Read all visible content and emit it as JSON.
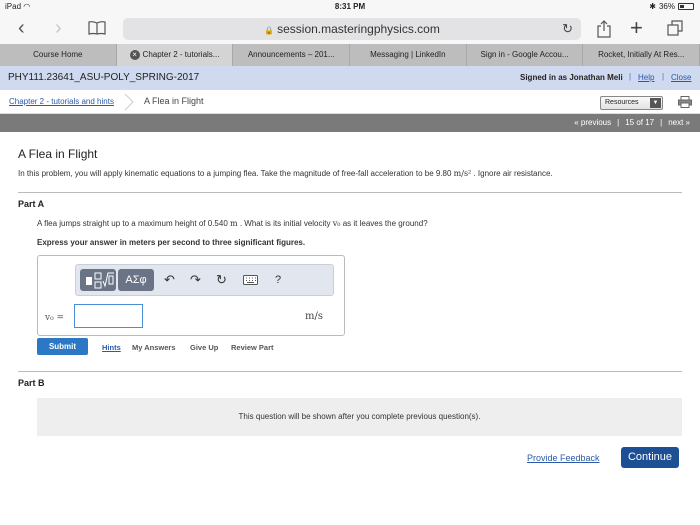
{
  "statusbar": {
    "device": "iPad",
    "time": "8:31 PM",
    "battery": "36%",
    "battery_level": 0.36
  },
  "browser": {
    "url": "session.masteringphysics.com"
  },
  "tabs": [
    {
      "label": "Course Home",
      "active": false
    },
    {
      "label": "Chapter 2 - tutorials...",
      "active": true
    },
    {
      "label": "Announcements – 201...",
      "active": false
    },
    {
      "label": "Messaging | LinkedIn",
      "active": false
    },
    {
      "label": "Sign in - Google Accou...",
      "active": false
    },
    {
      "label": "Rocket, Initially At Res...",
      "active": false
    }
  ],
  "header": {
    "course": "PHY111.23641_ASU-POLY_SPRING-2017",
    "signed_in": "Signed in as Jonathan Meli",
    "help": "Help",
    "close": "Close"
  },
  "breadcrumb": {
    "chapter": "Chapter 2 - tutorials and hints",
    "current": "A Flea in Flight",
    "resources": "Resources"
  },
  "pager": {
    "previous": "« previous",
    "position": "15 of 17",
    "next": "next »"
  },
  "problem": {
    "title": "A Flea in Flight",
    "intro_before": "In this problem, you will apply kinematic equations to a jumping flea. Take the magnitude of free-fall acceleration to be 9.80 ",
    "intro_unit": "m/s²",
    "intro_after": " . Ignore air resistance."
  },
  "part_a": {
    "label": "Part A",
    "question_before": "A flea jumps straight up to a maximum height of 0.540 ",
    "question_unit": "m",
    "question_mid": " . What is its initial velocity ",
    "question_var": "v₀",
    "question_after": " as it leaves the ground?",
    "instruction": "Express your answer in meters per second to three significant figures.",
    "var_label": "v₀ =",
    "answer_value": "",
    "unit": "m/s",
    "submit": "Submit",
    "hints": "Hints",
    "my_answers": "My Answers",
    "give_up": "Give Up",
    "review_part": "Review Part"
  },
  "part_b": {
    "label": "Part B",
    "message": "This question will be shown after you complete previous question(s)."
  },
  "footer": {
    "feedback": "Provide Feedback",
    "continue": "Continue"
  },
  "toolbar": {
    "template_icon": "fraction-sqrt-template-icon",
    "greek": "ΑΣφ",
    "undo_icon": "undo-icon",
    "redo_icon": "redo-icon",
    "reset_icon": "reset-icon",
    "keyboard_icon": "keyboard-icon",
    "help": "?"
  },
  "colors": {
    "submit": "#2c78c4",
    "continue": "#1d4f95",
    "link": "#2a5aa8",
    "header_bg": "#cfd9ef"
  }
}
